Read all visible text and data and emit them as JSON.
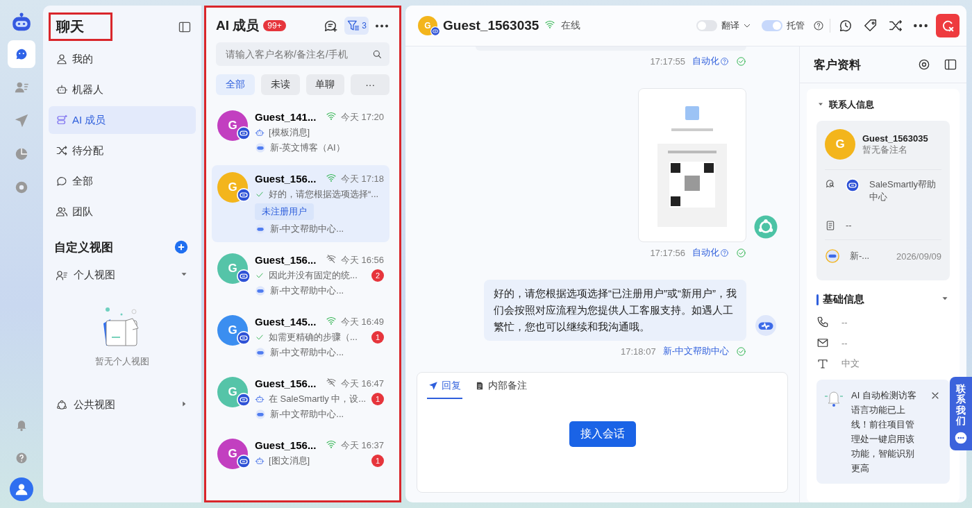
{
  "rail": {
    "items": [
      {
        "selected": true
      },
      {
        "selected": false
      },
      {
        "selected": false
      },
      {
        "selected": false
      },
      {
        "selected": false
      }
    ]
  },
  "nav": {
    "title": "聊天",
    "highlighted": true,
    "items": [
      {
        "label": "我的",
        "selected": false
      },
      {
        "label": "机器人",
        "selected": false
      },
      {
        "label": "AI 成员",
        "selected": true
      },
      {
        "label": "待分配",
        "selected": false
      },
      {
        "label": "全部",
        "selected": false
      },
      {
        "label": "团队",
        "selected": false
      }
    ],
    "custom_views": {
      "title": "自定义视图",
      "personal": {
        "label": "个人视图",
        "expanded": true,
        "empty_text": "暂无个人视图"
      },
      "public": {
        "label": "公共视图",
        "expanded": false
      }
    }
  },
  "conversation_list": {
    "title": "AI 成员",
    "count": "99+",
    "highlighted": true,
    "filter_count": "3",
    "search": {
      "placeholder": "请输入客户名称/备注名/手机"
    },
    "filters": [
      {
        "label": "全部",
        "selected": true
      },
      {
        "label": "未读",
        "selected": false
      },
      {
        "label": "单聊",
        "selected": false
      },
      {
        "label": "···",
        "selected": false
      }
    ],
    "items": [
      {
        "initial": "G",
        "color": "#c23fc0",
        "name": "Guest_141...",
        "online": true,
        "time": "今天 17:20",
        "kind": "robot",
        "preview": "[模板消息]",
        "agent": "新-英文博客（AI）",
        "selected": false
      },
      {
        "initial": "G",
        "color": "#f3b51c",
        "name": "Guest_156...",
        "online": true,
        "time": "今天 17:18",
        "kind": "check",
        "preview": "好的，请您根据选项选择“...",
        "tag": "未注册用户",
        "agent": "新-中文帮助中心...",
        "selected": true
      },
      {
        "initial": "G",
        "color": "#55c4a8",
        "name": "Guest_156...",
        "online": false,
        "time": "今天 16:56",
        "kind": "check",
        "preview": "因此并没有固定的统...",
        "unread": "2",
        "agent": "新-中文帮助中心...",
        "selected": false
      },
      {
        "initial": "G",
        "color": "#3b8ef0",
        "name": "Guest_145...",
        "online": true,
        "time": "今天 16:49",
        "kind": "check",
        "preview": "如需更精确的步骤（...",
        "unread": "1",
        "agent": "新-中文帮助中心...",
        "selected": false
      },
      {
        "initial": "G",
        "color": "#55c4a8",
        "name": "Guest_156...",
        "online": false,
        "time": "今天 16:47",
        "kind": "robot",
        "preview": "在 SaleSmartly 中，设...",
        "unread": "1",
        "agent": "新-中文帮助中心...",
        "selected": false
      },
      {
        "initial": "G",
        "color": "#c23fc0",
        "name": "Guest_156...",
        "online": true,
        "time": "今天 16:37",
        "kind": "robot",
        "preview": "[图文消息]",
        "unread": "1",
        "selected": false
      }
    ]
  },
  "chat": {
    "header": {
      "initial": "G",
      "color": "#f3b51c",
      "name": "Guest_1563035",
      "status": "在线",
      "online": true,
      "translate": {
        "label": "翻译",
        "on": false
      },
      "hosting": {
        "label": "托管",
        "on": true
      }
    },
    "messages": [
      {
        "kind": "partial",
        "time": "17:17:55",
        "sender": "自动化",
        "help": true
      },
      {
        "kind": "image",
        "time": "17:17:56",
        "sender": "自动化",
        "help": true
      },
      {
        "kind": "text",
        "text": "好的，请您根据选项选择“已注册用户”或“新用户”，我们会按照对应流程为您提供人工客服支持。如遇人工繁忙，您也可以继续和我沟通哦。",
        "time": "17:18:07",
        "sender": "新-中文帮助中心",
        "help": false
      }
    ],
    "composer": {
      "tabs": [
        {
          "label": "回复",
          "selected": true
        },
        {
          "label": "内部备注",
          "selected": false
        }
      ],
      "button": "接入会话"
    }
  },
  "profile": {
    "title": "客户资料",
    "contact": {
      "title": "联系人信息",
      "expanded": true,
      "initial": "G",
      "color": "#f3b51c",
      "name": "Guest_1563035",
      "remark": "暂无备注名",
      "channel": "SaleSmartly帮助中心",
      "note": "--",
      "agent": "新-...",
      "date": "2026/09/09"
    },
    "basic": {
      "title": "基础信息",
      "expanded": true,
      "rows": [
        {
          "value": "--"
        },
        {
          "value": "--"
        },
        {
          "value": "中文"
        }
      ]
    },
    "notice": "AI 自动检测访客语言功能已上线！前往项目管理处一键启用该功能，智能识别更高"
  },
  "contact_tab": "联系我们"
}
